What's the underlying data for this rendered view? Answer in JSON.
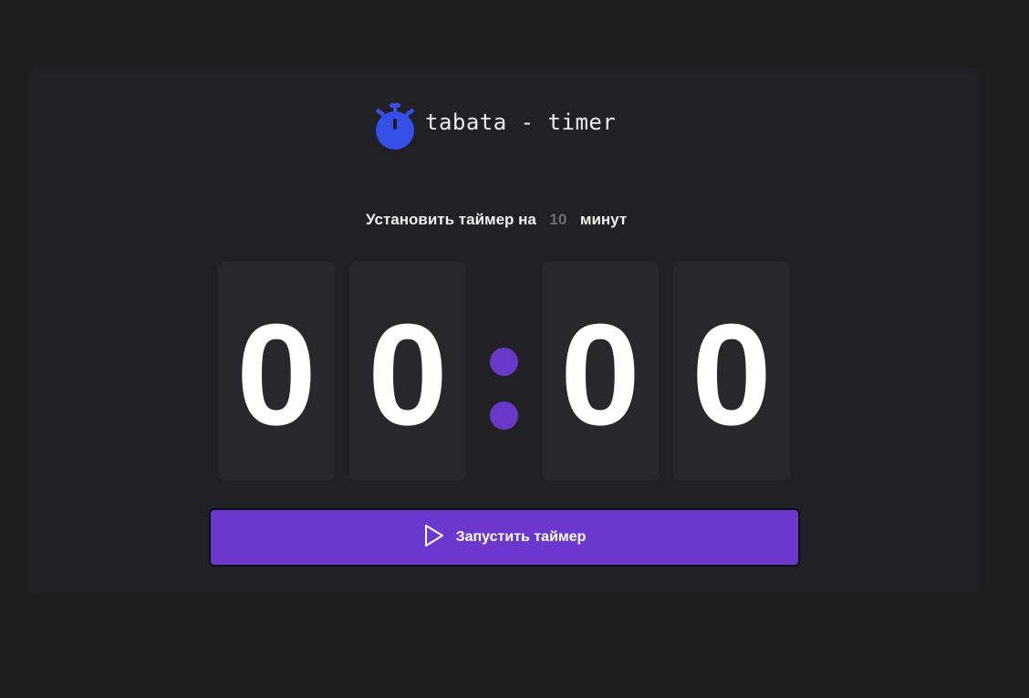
{
  "app": {
    "title": "tabata - timer",
    "logo_icon": "stopwatch-icon",
    "accent_color": "#6c37cc",
    "logo_color": "#3550e8"
  },
  "setter": {
    "prefix": "Установить таймер на",
    "minutes_value": "10",
    "suffix": "минут"
  },
  "timer": {
    "minutes_tens": "0",
    "minutes_ones": "0",
    "seconds_tens": "0",
    "seconds_ones": "0"
  },
  "start_button": {
    "label": "Запустить таймер",
    "icon": "play-icon"
  }
}
